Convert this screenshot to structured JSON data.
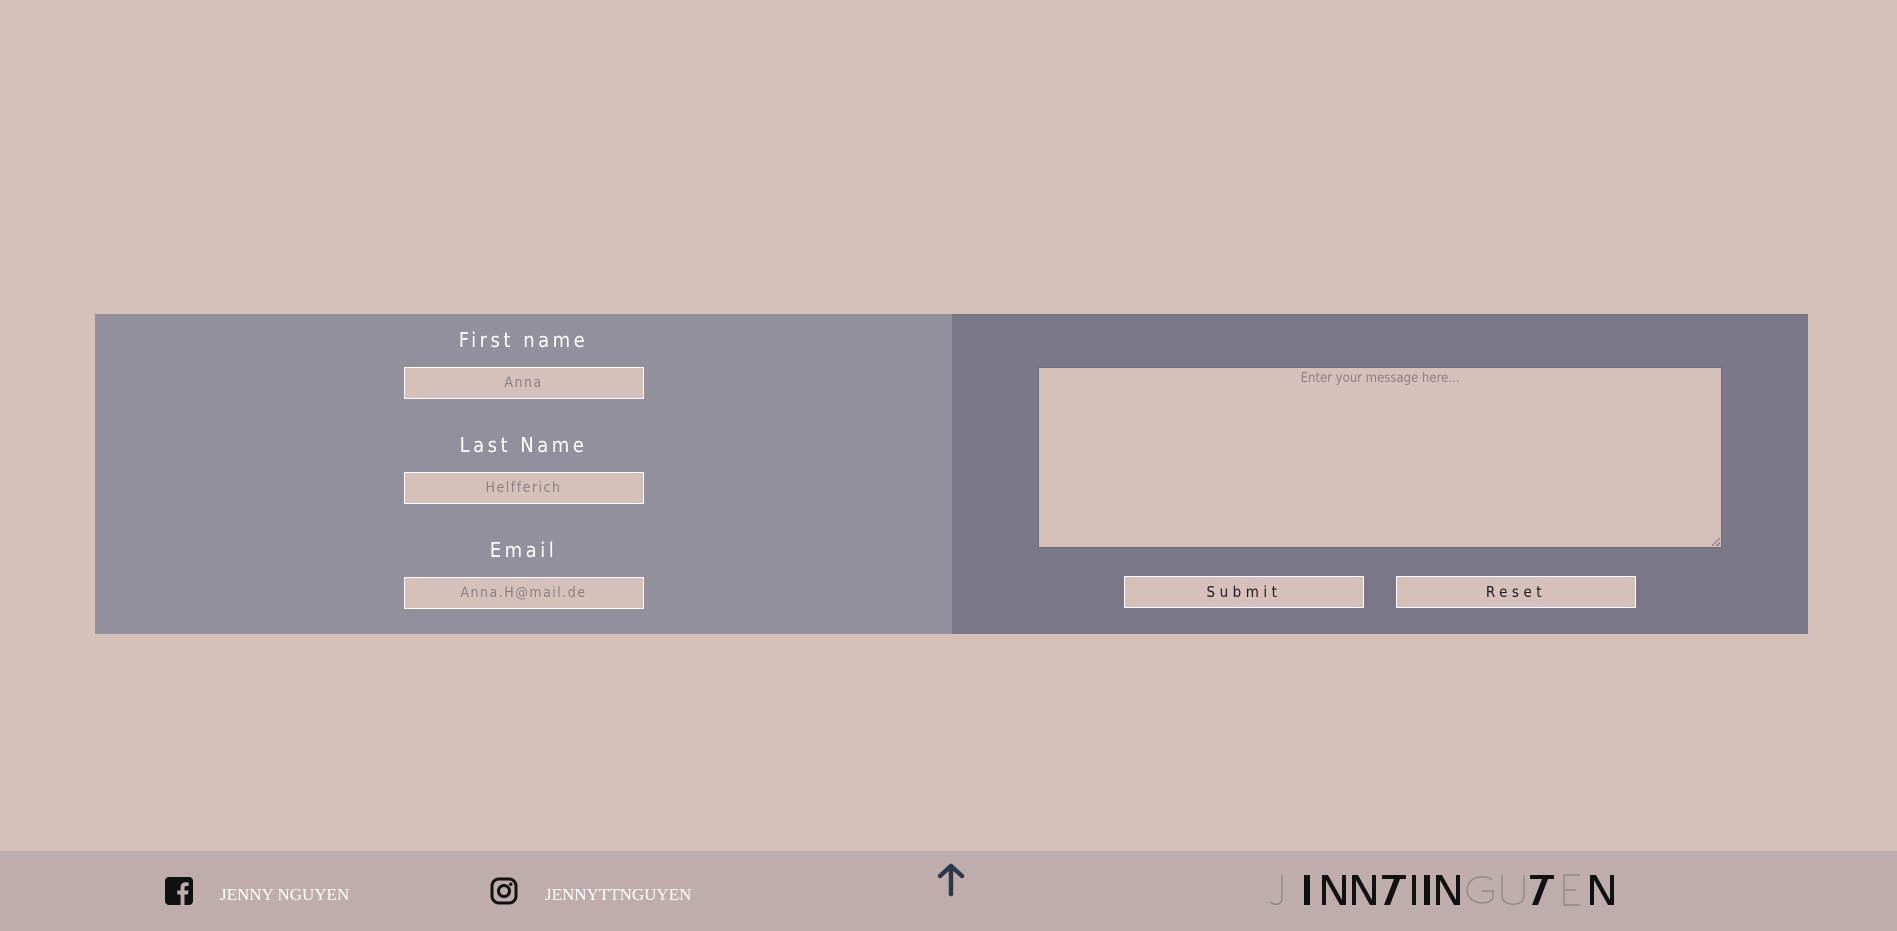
{
  "contact_form": {
    "first_name": {
      "label": "First name",
      "value": "Anna"
    },
    "last_name": {
      "label": "Last Name",
      "value": "Helfferich"
    },
    "email": {
      "label": "Email",
      "value": "Anna.H@mail.de"
    },
    "message": {
      "placeholder": "Enter your message here..."
    },
    "submit_label": "Submit",
    "reset_label": "Reset"
  },
  "footer": {
    "facebook": {
      "icon": "facebook-icon",
      "label": "JENNY NGUYEN"
    },
    "instagram": {
      "icon": "instagram-icon",
      "label": "JENNYTTNGUYEN"
    },
    "back_to_top": {
      "icon": "arrow-up-icon"
    },
    "logo": {
      "text": "JENNYTTNGUYEN"
    }
  },
  "colors": {
    "page_background": "#d6c1ba",
    "left_panel": "#93909d",
    "right_panel": "#7a7787",
    "footer_background": "#bfadad"
  }
}
